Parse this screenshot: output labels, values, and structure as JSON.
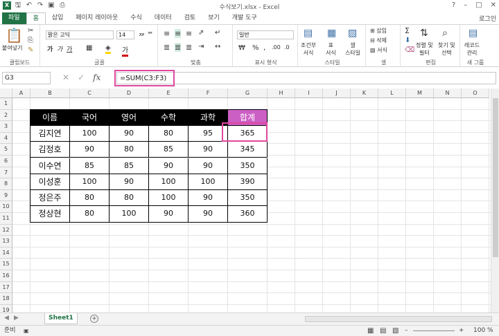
{
  "window": {
    "title": "수식보기.xlsx - Excel",
    "login": "로그인"
  },
  "tabs": [
    "파일",
    "홈",
    "삽입",
    "페이지 레이아웃",
    "수식",
    "데이터",
    "검토",
    "보기",
    "개발 도구"
  ],
  "ribbon": {
    "clipboard": {
      "paste": "붙여넣기",
      "label": "클립보드"
    },
    "font": {
      "name": "맑은 고딕",
      "size": "14",
      "label": "글꼴"
    },
    "align": {
      "label": "맞춤"
    },
    "number": {
      "format": "일반",
      "label": "표시 형식"
    },
    "style": {
      "cond": "조건부\n서식",
      "table": "표\n서식",
      "cellstyle": "셀\n스타일",
      "label": "스타일"
    },
    "cells": {
      "insert": "삽입",
      "delete": "삭제",
      "format": "서식",
      "label": "셀"
    },
    "edit": {
      "sort": "정렬 및\n필터",
      "find": "찾기 및\n선택",
      "label": "편집"
    },
    "newgroup": {
      "record": "레코드\n관리",
      "label": "새 그룹"
    }
  },
  "formula_bar": {
    "cell_ref": "G3",
    "formula": "=SUM(C3:F3)"
  },
  "columns": [
    "A",
    "B",
    "C",
    "D",
    "E",
    "F",
    "G",
    "H",
    "I",
    "J",
    "K",
    "L",
    "M",
    "N",
    "O"
  ],
  "rows": [
    "1",
    "2",
    "3",
    "4",
    "5",
    "6",
    "7",
    "8",
    "9",
    "10",
    "11",
    "12",
    "13",
    "14",
    "15",
    "16",
    "17",
    "18",
    "19"
  ],
  "table": {
    "headers": [
      "이름",
      "국어",
      "영어",
      "수학",
      "과학",
      "합계"
    ],
    "rows": [
      [
        "김지연",
        "100",
        "90",
        "80",
        "95",
        "365"
      ],
      [
        "김정호",
        "90",
        "80",
        "85",
        "90",
        "345"
      ],
      [
        "이수연",
        "85",
        "85",
        "90",
        "90",
        "350"
      ],
      [
        "이성훈",
        "100",
        "90",
        "100",
        "100",
        "390"
      ],
      [
        "정은주",
        "80",
        "80",
        "100",
        "90",
        "350"
      ],
      [
        "정상현",
        "80",
        "100",
        "90",
        "90",
        "360"
      ]
    ]
  },
  "sheets": [
    "Sheet1"
  ],
  "status": {
    "mode": "준비",
    "zoom": "100 %"
  },
  "colors": {
    "excel_green": "#217346",
    "total_header": "#cc5fc4",
    "highlight": "#e0479e"
  }
}
